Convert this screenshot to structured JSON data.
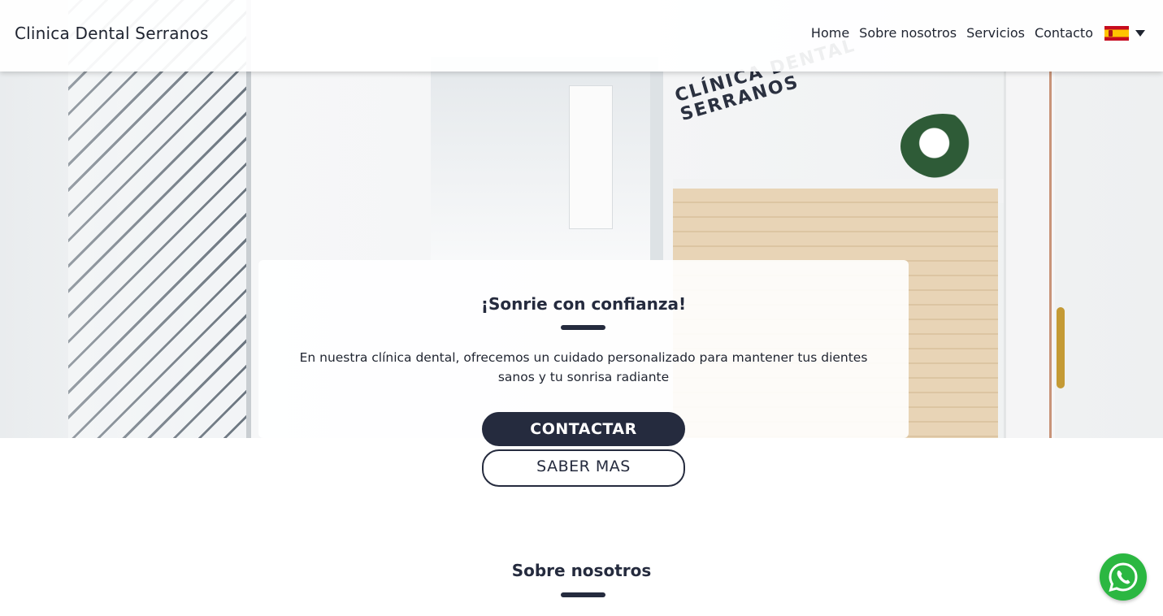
{
  "header": {
    "brand": "Clinica Dental Serranos",
    "nav": [
      "Home",
      "Sobre nosotros",
      "Servicios",
      "Contacto"
    ],
    "language_icon": "spain-flag-icon",
    "dropdown_icon": "caret-down-icon"
  },
  "hero": {
    "wall_logo_line1": "CLÍNICA DENTAL",
    "wall_logo_line2": "SERRANOS",
    "title": "¡Sonrie con confianza!",
    "text": "En nuestra clínica dental, ofrecemos un cuidado personalizado para mantener tus dientes sanos y tu sonrisa radiante",
    "primary_button": "CONTACTAR",
    "secondary_button": "SABER MAS"
  },
  "section": {
    "title": "Sobre nosotros"
  },
  "whatsapp": {
    "icon": "whatsapp-icon"
  },
  "colors": {
    "accent": "#252b3e",
    "whatsapp": "#2bb741"
  }
}
